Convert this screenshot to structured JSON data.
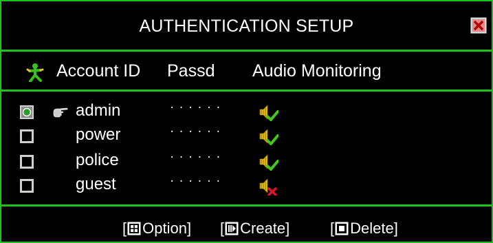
{
  "window": {
    "title": "AUTHENTICATION SETUP"
  },
  "colors": {
    "border": "#1ec21e",
    "background": "#000000",
    "text": "#ffffff",
    "check": "#49c61b",
    "cross": "#d9152c",
    "speaker": "#e8c21a"
  },
  "table": {
    "headers": {
      "account_id": "Account ID",
      "password": "Passd",
      "audio": "Audio Monitoring"
    },
    "rows": [
      {
        "selected": true,
        "current": true,
        "account": "admin",
        "password": "······",
        "audio": "enabled"
      },
      {
        "selected": false,
        "current": false,
        "account": "power",
        "password": "······",
        "audio": "enabled"
      },
      {
        "selected": false,
        "current": false,
        "account": "police",
        "password": "······",
        "audio": "enabled"
      },
      {
        "selected": false,
        "current": false,
        "account": "guest",
        "password": "······",
        "audio": "disabled"
      }
    ]
  },
  "footer": {
    "option": {
      "label": "Option]",
      "open": "[",
      "icon": "grid-icon"
    },
    "create": {
      "label": "Create]",
      "open": "[",
      "icon": "play-pause-icon"
    },
    "delete": {
      "label": "Delete]",
      "open": "[",
      "icon": "stop-icon"
    }
  }
}
